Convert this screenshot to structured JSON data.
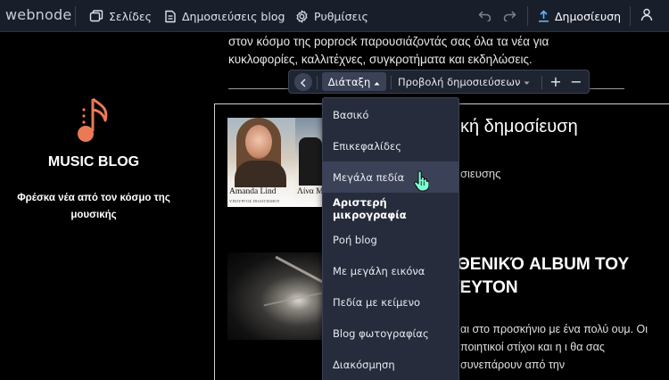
{
  "topbar": {
    "logo": "webnode",
    "nav": [
      {
        "label": "Σελίδες",
        "icon": "pages-icon"
      },
      {
        "label": "Δημοσιεύσεις blog",
        "icon": "blog-posts-icon"
      },
      {
        "label": "Ρυθμίσεις",
        "icon": "gear-icon"
      }
    ],
    "undo_icon": "undo-icon",
    "redo_icon": "redo-icon",
    "publish_label": "Δημοσίευση",
    "publish_icon": "upload-icon",
    "account_icon": "user-icon"
  },
  "site": {
    "brand_icon": "music-note-icon",
    "brand_color": "#e97a55",
    "title": "MUSIC BLOG",
    "subtitle": "Φρέσκα νέα από τον κόσμο της μουσικής",
    "intro": "στον κόσμο της poprock παρουσιάζοντάς σας όλα τα νέα για κυκλοφορίες, καλλιτέχνες, συγκροτήματα και εκδηλώσεις."
  },
  "posts": [
    {
      "title": "κή δημοσίευση",
      "meta": "σιευσης",
      "thumb_caption": "Amanda Lind",
      "thumb_caption_small": "ΥΠΟΥΡΓΟΣ ΠΟΛΙΤΙΣΜΟΥ",
      "thumb_caption_b": "Λίνα Μ"
    },
    {
      "title": "ΘΕΝΙΚΌ ALBUM ΤΟΥ ΈΥΤΟΝ",
      "text": "αι στο προσκήνιο με ένα πολύ ουμ. Οι ποιητικοί στίχοι και η ι θα σας συνεπάρουν από την"
    }
  ],
  "toolbar": {
    "back_icon": "chevron-left-icon",
    "layout_label": "Διάταξη",
    "layout_caret": "caret-up-icon",
    "view_label": "Προβολή δημοσιεύσεων",
    "view_caret": "caret-down-icon",
    "plus": "+",
    "minus": "−"
  },
  "layout_menu": {
    "items": [
      {
        "label": "Βασικό"
      },
      {
        "label": "Επικεφαλίδες"
      },
      {
        "label": "Μεγάλα πεδία",
        "state": "hover"
      },
      {
        "label": "Αριστερή μικρογραφία",
        "state": "selected"
      },
      {
        "label": "Ροή blog"
      },
      {
        "label": "Με μεγάλη εικόνα"
      },
      {
        "label": "Πεδία με κείμενο"
      },
      {
        "label": "Blog φωτογραφίας"
      },
      {
        "label": "Διακόσμηση"
      }
    ]
  },
  "colors": {
    "topbar_bg": "#191e2b",
    "menu_bg": "#262c3b",
    "menu_hover": "#3b4257",
    "publish_icon": "#5cb6ff",
    "page_bg": "#000000"
  }
}
